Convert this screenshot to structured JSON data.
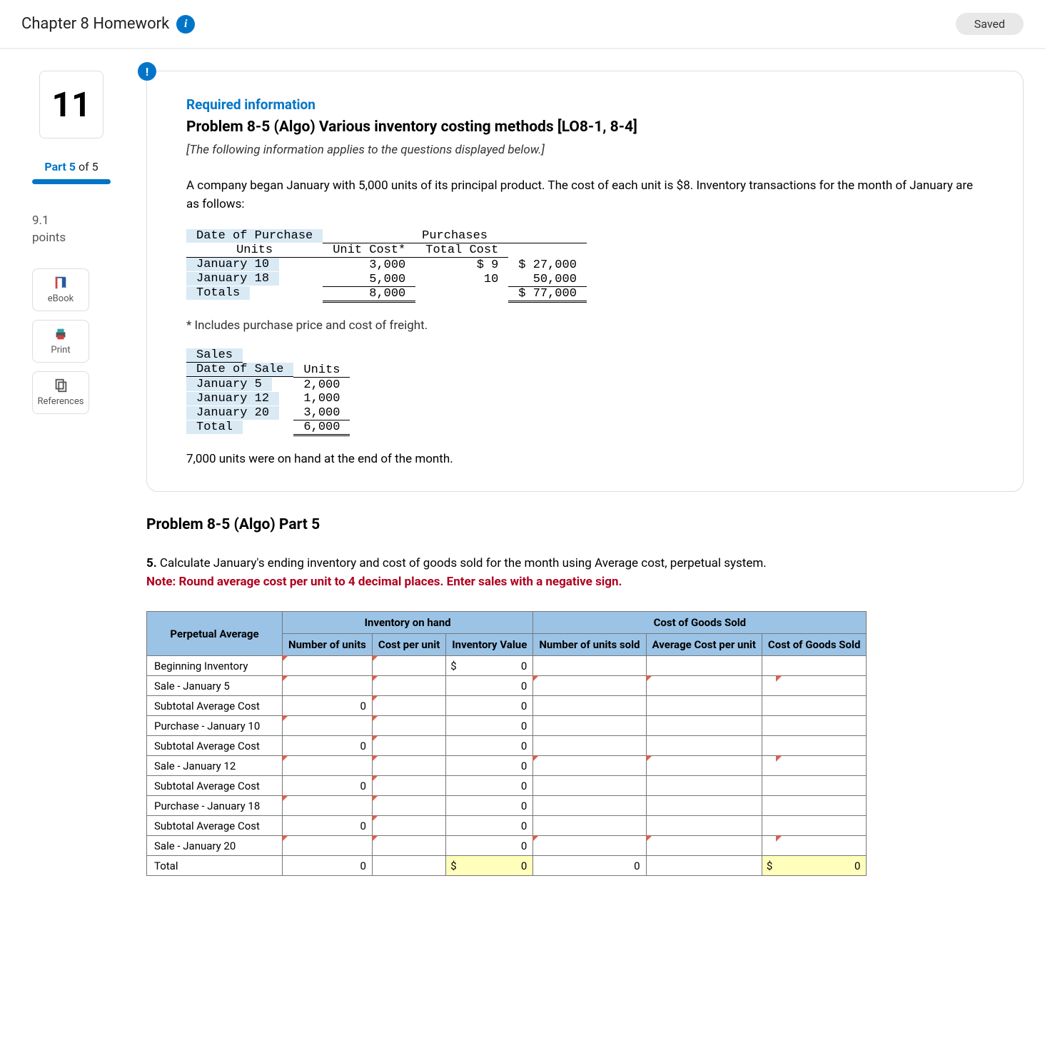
{
  "header": {
    "title": "Chapter 8 Homework",
    "saved": "Saved"
  },
  "side": {
    "q": "11",
    "part_b": "Part 5",
    "part_of": " of 5",
    "points_a": "9.1",
    "points_b": "points",
    "tools": {
      "ebook": "eBook",
      "print": "Print",
      "refs": "References"
    }
  },
  "card": {
    "req": "Required information",
    "title": "Problem 8-5 (Algo) Various inventory costing methods [LO8-1, 8-4]",
    "applies": "[The following information applies to the questions displayed below.]",
    "desc": "A company began January with 5,000 units of its principal product. The cost of each unit is $8. Inventory transactions for the month of January are as follows:",
    "purch": {
      "dop": "Date of Purchase",
      "ph": "Purchases",
      "u": "Units",
      "uc": "Unit Cost*",
      "tc": "Total Cost",
      "r1": {
        "d": "January 10",
        "u": "3,000",
        "c": "$ 9",
        "t": "$ 27,000"
      },
      "r2": {
        "d": "January 18",
        "u": "5,000",
        "c": "10",
        "t": "50,000"
      },
      "tot": {
        "d": "Totals",
        "u": "8,000",
        "t": "$ 77,000"
      }
    },
    "foot": "* Includes purchase price and cost of freight.",
    "sales": {
      "h": "Sales",
      "dos": "Date of Sale",
      "u": "Units",
      "r1": {
        "d": "January 5",
        "u": "2,000"
      },
      "r2": {
        "d": "January 12",
        "u": "1,000"
      },
      "r3": {
        "d": "January 20",
        "u": "3,000"
      },
      "tot": {
        "d": "Total",
        "u": "6,000"
      }
    },
    "end": "7,000 units were on hand at the end of the month."
  },
  "below": {
    "title": "Problem 8-5 (Algo) Part 5",
    "num": "5.",
    "instr": " Calculate January's ending inventory and cost of goods sold for the month using Average cost, perpetual system.",
    "note": "Note: Round average cost per unit to 4 decimal places. Enter sales with a negative sign.",
    "th": {
      "pa": "Perpetual Average",
      "ioh": "Inventory on hand",
      "cogs": "Cost of Goods Sold",
      "nu": "Number of units",
      "cpu": "Cost per unit",
      "iv": "Inventory Value",
      "nus": "Number of units sold",
      "acu": "Average Cost per unit",
      "cogsv": "Cost of Goods Sold"
    },
    "rows": {
      "r0": "Beginning Inventory",
      "r1": "Sale - January 5",
      "r2": "Subtotal Average Cost",
      "r3": "Purchase - January 10",
      "r4": "Subtotal Average Cost",
      "r5": "Sale - January 12",
      "r6": "Subtotal Average Cost",
      "r7": "Purchase - January 18",
      "r8": "Subtotal Average Cost",
      "r9": "Sale - January 20",
      "rt": "Total"
    },
    "v": {
      "zero": "0",
      "dollar": "$"
    }
  }
}
